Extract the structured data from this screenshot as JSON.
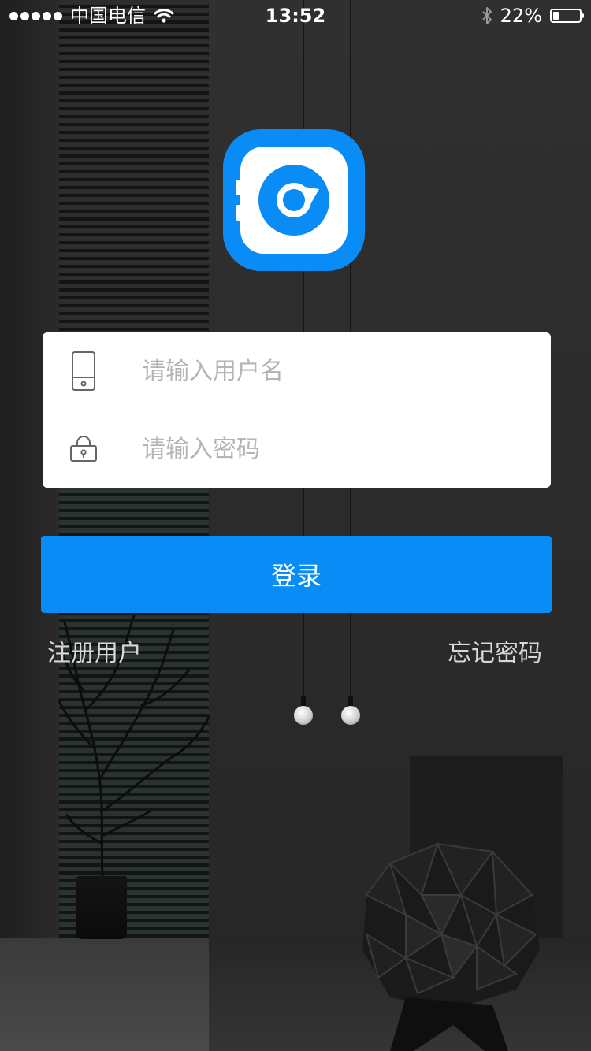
{
  "status_bar": {
    "carrier": "中国电信",
    "time": "13:52",
    "battery_percent": "22%",
    "battery_level": 0.22,
    "signal_bars": 5,
    "icons": [
      "signal-dots-icon",
      "wifi-icon",
      "bluetooth-icon",
      "battery-icon"
    ]
  },
  "logo": {
    "icon": "app-logo-icon",
    "color": "#0a8cf6"
  },
  "login_form": {
    "username": {
      "icon": "phone-icon",
      "placeholder": "请输入用户名",
      "value": ""
    },
    "password": {
      "icon": "lock-icon",
      "placeholder": "请输入密码",
      "value": ""
    }
  },
  "login_button": {
    "label": "登录",
    "color": "#0a8cf6"
  },
  "links": {
    "register": "注册用户",
    "forgot_password": "忘记密码"
  }
}
